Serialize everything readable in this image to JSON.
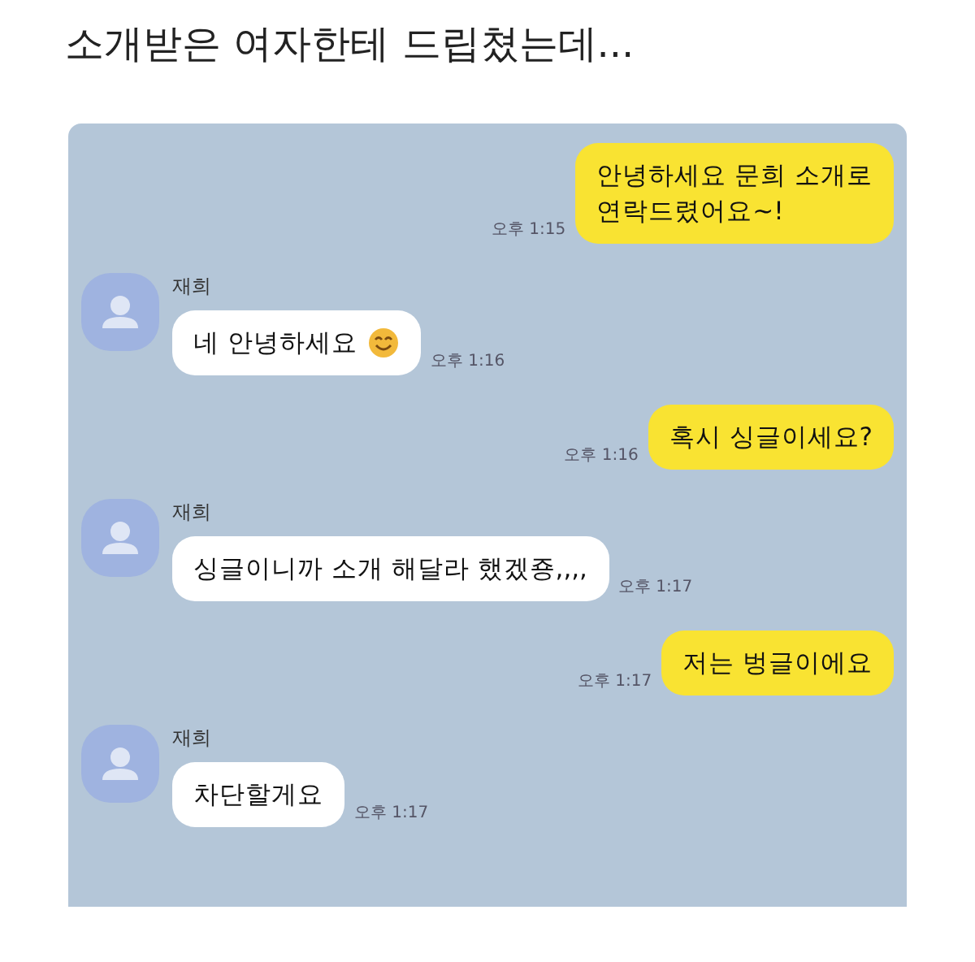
{
  "title": "소개받은 여자한테 드립쳤는데...",
  "messages": [
    {
      "kind": "sent",
      "text": "안녕하세요 문희 소개로\n연락드렸어요~!",
      "time": "오후 1:15"
    },
    {
      "kind": "received",
      "sender": "재희",
      "text": "네 안녕하세요",
      "emoji": true,
      "time": "오후 1:16"
    },
    {
      "kind": "sent",
      "text": "혹시 싱글이세요?",
      "time": "오후 1:16"
    },
    {
      "kind": "received",
      "sender": "재희",
      "text": "싱글이니까 소개 해달라 했겠죵,,,,",
      "emoji": false,
      "time": "오후 1:17"
    },
    {
      "kind": "sent",
      "text": "저는 벙글이에요",
      "time": "오후 1:17"
    },
    {
      "kind": "received",
      "sender": "재희",
      "text": "차단할게요",
      "emoji": false,
      "time": "오후 1:17"
    }
  ]
}
